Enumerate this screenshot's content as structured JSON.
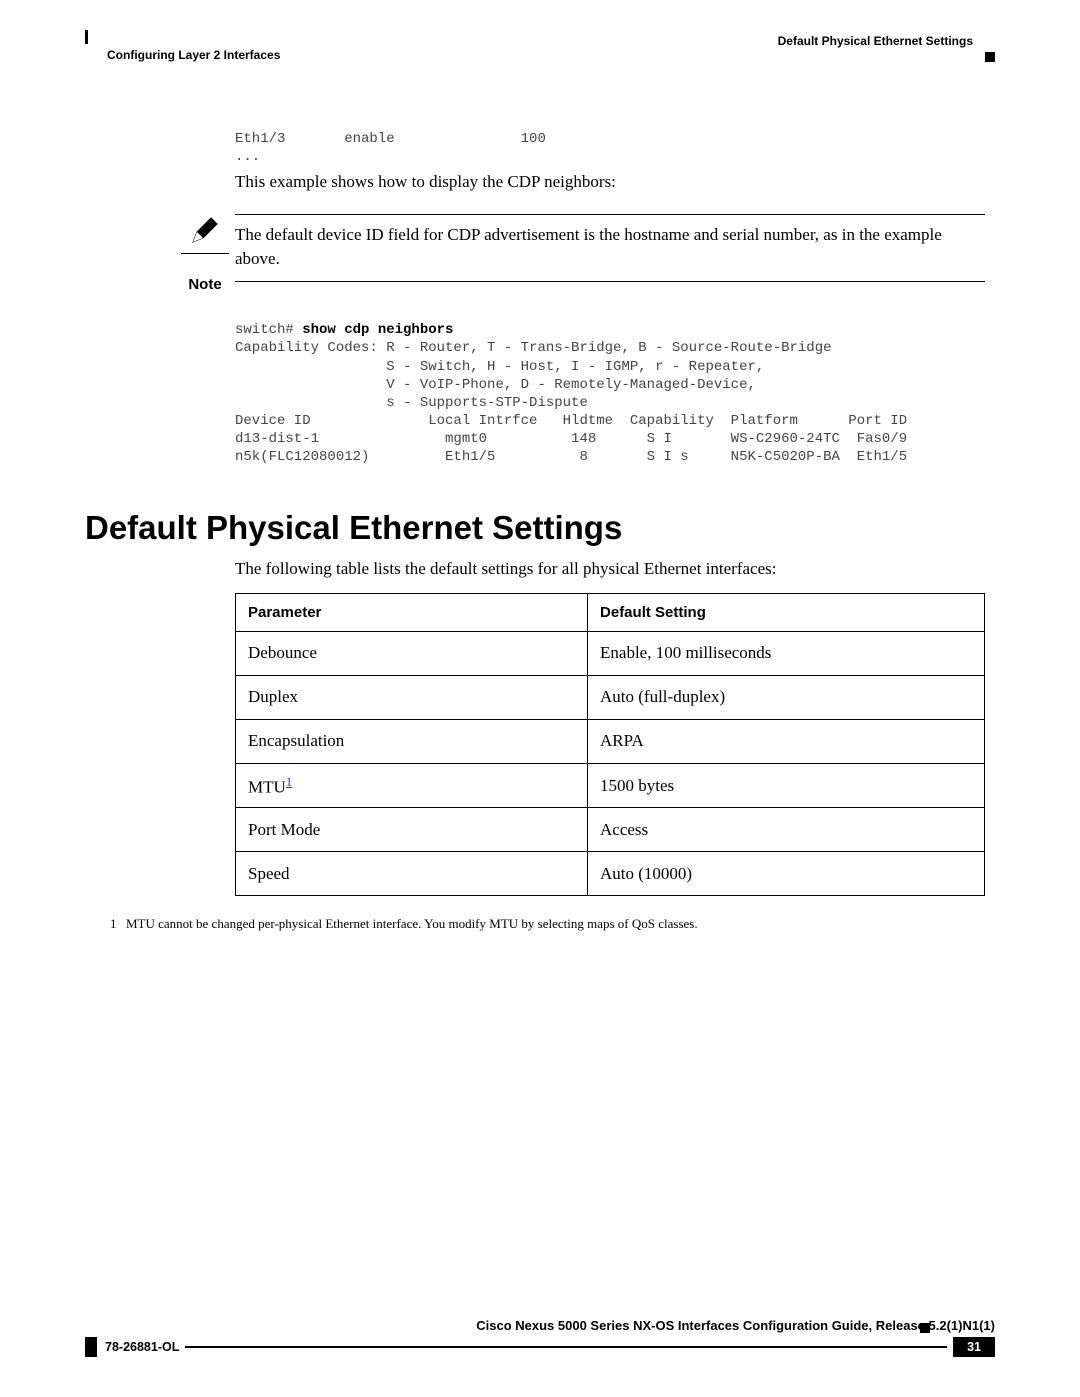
{
  "header": {
    "chapter": "Configuring Layer 2 Interfaces",
    "section": "Default Physical Ethernet Settings"
  },
  "cli1": {
    "line1": "Eth1/3       enable               100",
    "line2": "..."
  },
  "example_intro": "This example shows how to display the CDP neighbors:",
  "note": {
    "label": "Note",
    "text": "The default device ID field for CDP advertisement is the hostname and serial number, as in the example above."
  },
  "cli2": {
    "prompt": "switch# ",
    "command": "show cdp neighbors",
    "l1": "Capability Codes: R - Router, T - Trans-Bridge, B - Source-Route-Bridge",
    "l2": "                  S - Switch, H - Host, I - IGMP, r - Repeater,",
    "l3": "                  V - VoIP-Phone, D - Remotely-Managed-Device,",
    "l4": "                  s - Supports-STP-Dispute",
    "l5": "Device ID              Local Intrfce   Hldtme  Capability  Platform      Port ID",
    "l6": "d13-dist-1               mgmt0          148      S I       WS-C2960-24TC  Fas0/9",
    "l7": "n5k(FLC12080012)         Eth1/5          8       S I s     N5K-C5020P-BA  Eth1/5"
  },
  "h1": "Default Physical Ethernet Settings",
  "table_intro": "The following table lists the default settings for all physical Ethernet interfaces:",
  "table": {
    "headers": {
      "param": "Parameter",
      "setting": "Default Setting"
    },
    "rows": [
      {
        "param": "Debounce",
        "setting": "Enable, 100 milliseconds",
        "footnote": false
      },
      {
        "param": "Duplex",
        "setting": "Auto (full-duplex)",
        "footnote": false
      },
      {
        "param": "Encapsulation",
        "setting": "ARPA",
        "footnote": false
      },
      {
        "param": "MTU",
        "setting": "1500 bytes",
        "footnote": true
      },
      {
        "param": "Port Mode",
        "setting": "Access",
        "footnote": false
      },
      {
        "param": "Speed",
        "setting": "Auto (10000)",
        "footnote": false
      }
    ]
  },
  "footnote": {
    "num": "1",
    "ref": "1",
    "text": "MTU cannot be changed per-physical Ethernet interface. You modify MTU by selecting maps of QoS classes."
  },
  "footer": {
    "guide": "Cisco Nexus 5000 Series NX-OS Interfaces Configuration Guide, Release 5.2(1)N1(1)",
    "docnum": "78-26881-OL",
    "page": "31"
  }
}
